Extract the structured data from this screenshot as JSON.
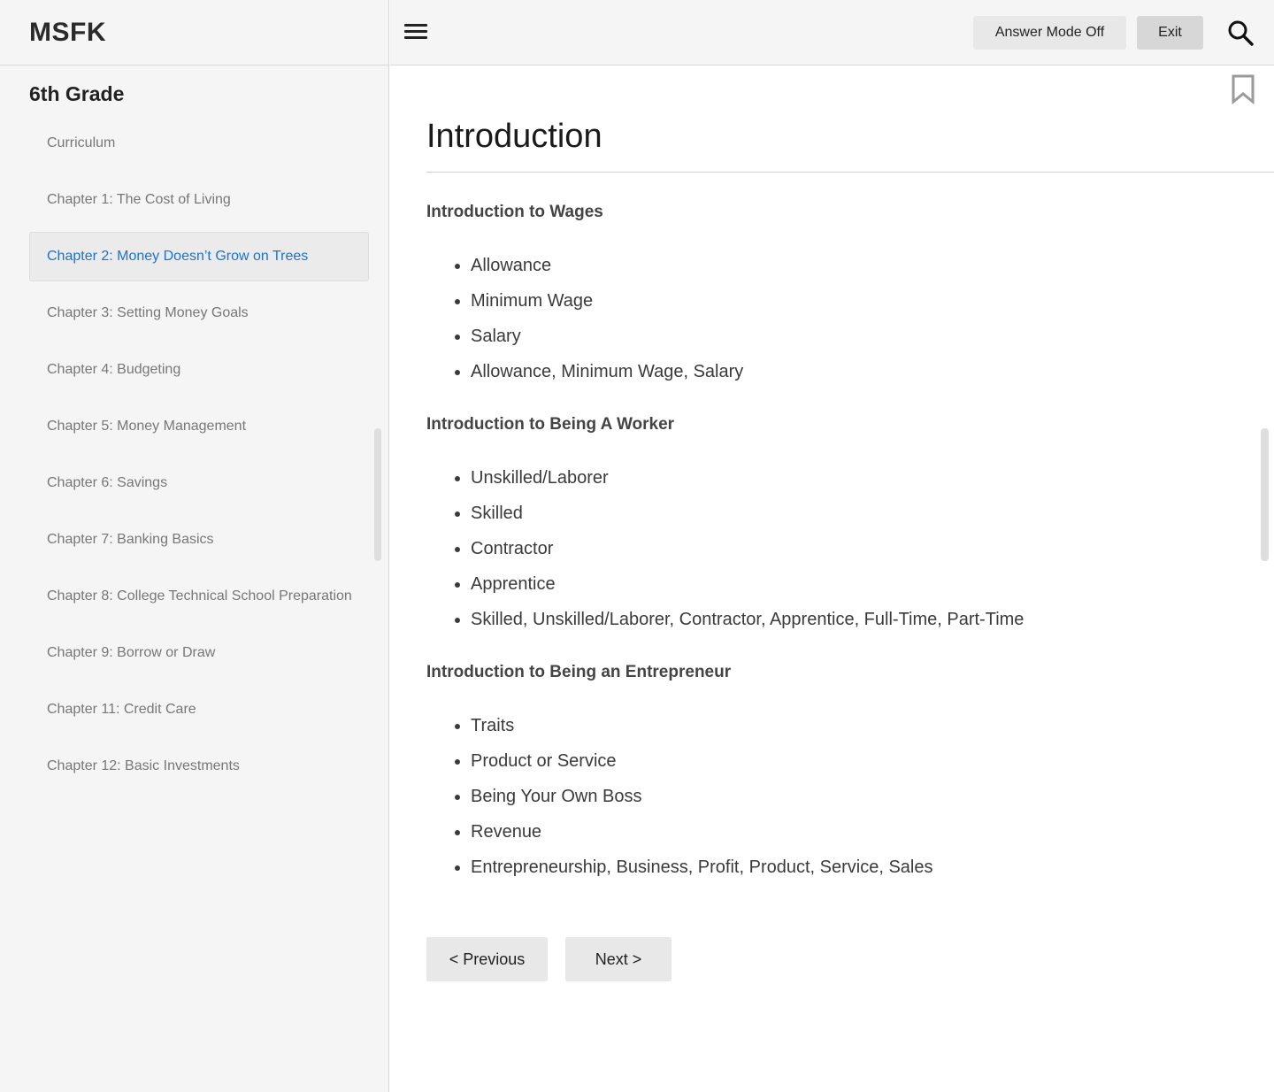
{
  "app": {
    "brand": "MSFK"
  },
  "sidebar": {
    "grade_title": "6th Grade",
    "items": [
      {
        "label": "Curriculum",
        "active": false
      },
      {
        "label": "Chapter 1: The Cost of Living",
        "active": false
      },
      {
        "label": "Chapter 2: Money Doesn’t Grow on Trees",
        "active": true
      },
      {
        "label": "Chapter 3: Setting Money Goals",
        "active": false
      },
      {
        "label": "Chapter 4: Budgeting",
        "active": false
      },
      {
        "label": "Chapter 5: Money Management",
        "active": false
      },
      {
        "label": "Chapter 6: Savings",
        "active": false
      },
      {
        "label": "Chapter 7: Banking Basics",
        "active": false
      },
      {
        "label": "Chapter 8: College Technical School Preparation",
        "active": false
      },
      {
        "label": "Chapter 9: Borrow or Draw",
        "active": false
      },
      {
        "label": "Chapter 11: Credit Care",
        "active": false
      },
      {
        "label": "Chapter 12: Basic Investments",
        "active": false
      }
    ]
  },
  "toolbar": {
    "menu_icon": "hamburger-menu-icon",
    "answer_mode_label": "Answer Mode Off",
    "exit_label": "Exit",
    "search_icon": "search-icon"
  },
  "main": {
    "bookmark_icon": "bookmark-icon",
    "title": "Introduction",
    "sections": [
      {
        "heading": "Introduction to Wages",
        "items": [
          "Allowance",
          "Minimum Wage",
          "Salary",
          "Allowance, Minimum Wage, Salary"
        ]
      },
      {
        "heading": "Introduction to Being A Worker",
        "items": [
          "Unskilled/Laborer",
          "Skilled",
          "Contractor",
          "Apprentice",
          "Skilled, Unskilled/Laborer, Contractor, Apprentice, Full-Time, Part-Time"
        ]
      },
      {
        "heading": "Introduction to Being an Entrepreneur",
        "items": [
          "Traits",
          "Product or Service",
          "Being Your Own Boss",
          "Revenue",
          "Entrepreneurship, Business, Profit, Product, Service, Sales"
        ]
      }
    ],
    "pager": {
      "previous_label": "< Previous",
      "next_label": "Next >"
    }
  },
  "colors": {
    "active_link": "#1a73d1",
    "sidebar_bg": "#f5f5f5",
    "button_bg": "#e8e8e8"
  }
}
